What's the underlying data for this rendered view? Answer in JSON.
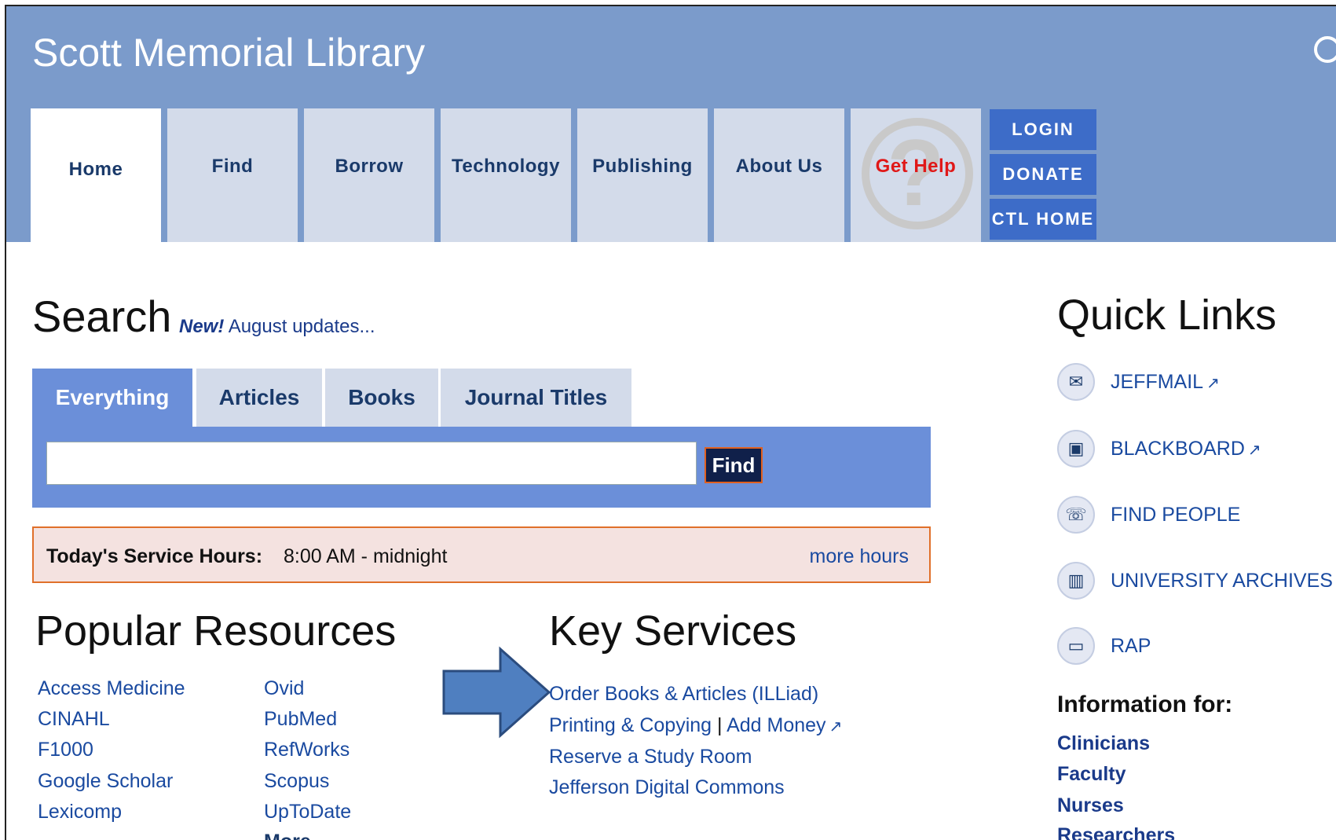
{
  "header": {
    "title": "Scott Memorial Library"
  },
  "nav": {
    "tabs": [
      {
        "label": "Home"
      },
      {
        "label": "Find"
      },
      {
        "label": "Borrow"
      },
      {
        "label": "Technology"
      },
      {
        "label": "Publishing"
      },
      {
        "label": "About Us"
      },
      {
        "label": "Get Help"
      }
    ],
    "utility": {
      "login": "LOGIN",
      "donate": "DONATE",
      "ctl_home": "CTL HOME"
    }
  },
  "search": {
    "heading": "Search",
    "new_label": "New!",
    "new_text": "August updates...",
    "tabs": [
      "Everything",
      "Articles",
      "Books",
      "Journal Titles"
    ],
    "input_value": "",
    "find_label": "Find"
  },
  "hours": {
    "label": "Today's Service Hours:",
    "value": "8:00 AM - midnight",
    "more": "more hours"
  },
  "popular": {
    "title": "Popular Resources",
    "col1": [
      "Access Medicine",
      "CINAHL",
      "F1000",
      "Google Scholar",
      "Lexicomp"
    ],
    "col2": [
      "Ovid",
      "PubMed",
      "RefWorks",
      "Scopus",
      "UpToDate"
    ],
    "more": "More"
  },
  "services": {
    "title": "Key Services",
    "illiad": "Order Books & Articles (ILLiad)",
    "printing": "Printing & Copying",
    "separator": "|",
    "add_money": "Add Money",
    "study_room": "Reserve a Study Room",
    "commons": "Jefferson Digital Commons"
  },
  "quick_links": {
    "title": "Quick Links",
    "items": [
      {
        "label": "JEFFMAIL",
        "icon": "envelope-icon"
      },
      {
        "label": "BLACKBOARD",
        "icon": "presentation-icon"
      },
      {
        "label": "FIND PEOPLE",
        "icon": "phone-icon"
      },
      {
        "label": "UNIVERSITY ARCHIVES",
        "icon": "book-icon"
      },
      {
        "label": "RAP",
        "icon": "monitor-icon"
      }
    ]
  },
  "info_for": {
    "title": "Information for:",
    "items": [
      "Clinicians",
      "Faculty",
      "Nurses",
      "Researchers"
    ]
  },
  "colors": {
    "banner": "#7b9bcb",
    "accent": "#3d6cc8",
    "search_panel": "#6b8fd9",
    "alert": "#e01818"
  }
}
